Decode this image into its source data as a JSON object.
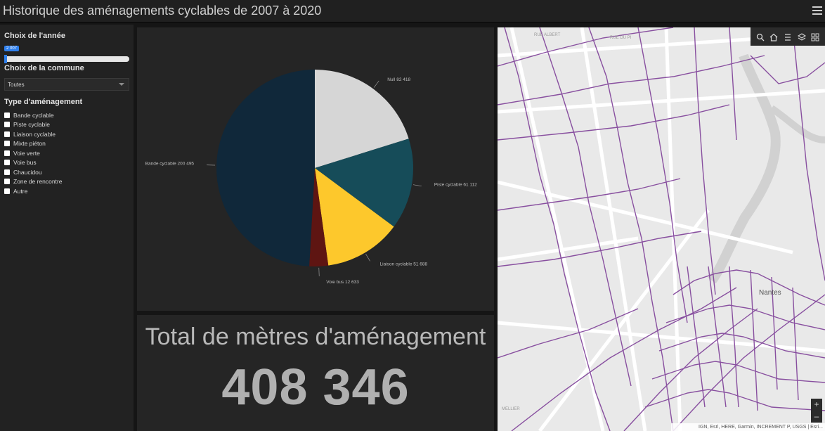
{
  "header": {
    "title": "Historique des aménagements cyclables de 2007 à 2020"
  },
  "sidebar": {
    "year_title": "Choix de l'année",
    "year_value": "2 007",
    "year_progress": 0,
    "commune_title": "Choix de la commune",
    "commune_selected": "Toutes",
    "type_title": "Type d'aménagement",
    "types": [
      "Bande cyclable",
      "Piste cyclable",
      "Liaison cyclable",
      "Mixte piéton",
      "Voie verte",
      "Voie bus",
      "Chaucidou",
      "Zone de rencontre",
      "Autre"
    ]
  },
  "chart_data": {
    "type": "pie",
    "slices": [
      {
        "label": "Null 82 418",
        "value": 82418,
        "color": "#d6d6d6"
      },
      {
        "label": "Piste cyclable 61 112",
        "value": 61112,
        "color": "#164c59"
      },
      {
        "label": "Liaison cyclable 51 688",
        "value": 51688,
        "color": "#fdc82c"
      },
      {
        "label": "Voie bus 12 633",
        "value": 12633,
        "color": "#5e1512"
      },
      {
        "label": "Bande cyclable 200 495",
        "value": 200495,
        "color": "#10283a"
      }
    ]
  },
  "total": {
    "label": "Total de mètres d'aménagement",
    "value": "408 346"
  },
  "map": {
    "city_label": "Nantes",
    "attribution": "IGN, Esri, HERE, Garmin, INCREMENT P, USGS | Esri...",
    "street_labels": [
      "RUE ALBERT",
      "RUE DU PI",
      "MELLIER"
    ],
    "toolbar_icons": [
      "search-icon",
      "home-icon",
      "list-icon",
      "layers-icon",
      "basemap-icon"
    ],
    "zoom_in": "+",
    "zoom_out": "–"
  }
}
